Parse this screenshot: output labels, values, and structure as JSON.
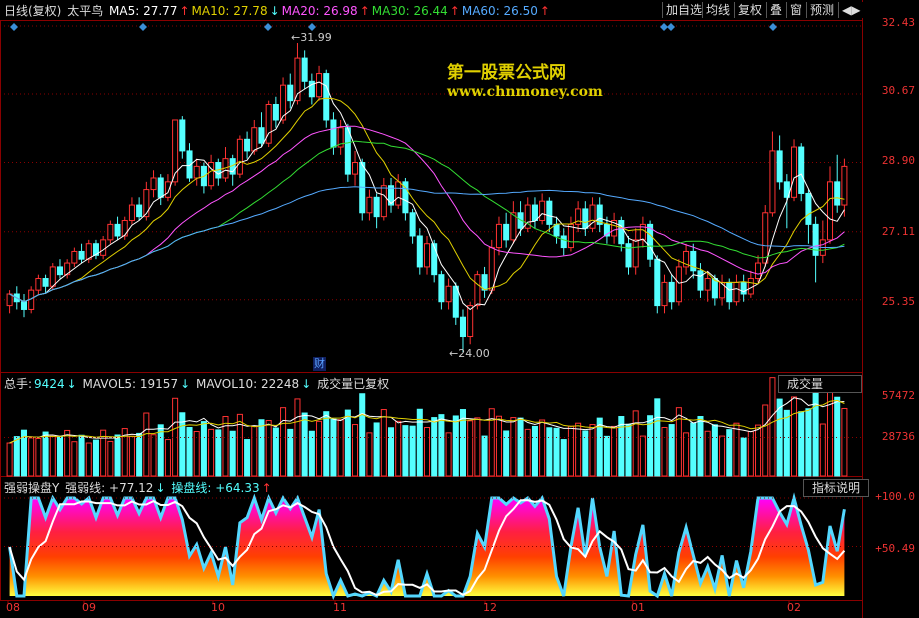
{
  "header": {
    "period": "日线(复权)",
    "symbol": "太平鸟",
    "ma": [
      {
        "label": "MA5: 27.77",
        "arrow": "↑",
        "color": "#ffffff"
      },
      {
        "label": "MA10: 27.78",
        "arrow": "↓",
        "color": "#e0d000"
      },
      {
        "label": "MA20: 26.98",
        "arrow": "↑",
        "color": "#ff55ff"
      },
      {
        "label": "MA30: 26.44",
        "arrow": "↑",
        "color": "#33dd33"
      },
      {
        "label": "MA60: 26.50",
        "arrow": "↑",
        "color": "#55aaff"
      }
    ]
  },
  "toolbar": {
    "add_watchlist": "加自选",
    "ma_line": "均线",
    "adjust": "复权",
    "overlay": "叠",
    "window": "窗",
    "predict": "预测",
    "nav": "◀▶"
  },
  "watermark": {
    "line1": "第一股票公式网",
    "line2": "www.chnmoney.com"
  },
  "price_axis": [
    "32.43",
    "30.67",
    "28.90",
    "27.11",
    "25.35"
  ],
  "annotations": {
    "high": "31.99",
    "low": "24.00",
    "finance_marker": "财"
  },
  "volume": {
    "title": "总手:",
    "value": "9424",
    "v_arrow": "↓",
    "mavol5": "MAVOL5: 19157",
    "m5_arrow": "↓",
    "mavol10": "MAVOL10: 22248",
    "m10_arrow": "↓",
    "note": "成交量已复权",
    "button": "成交量",
    "axis": [
      "57472",
      "28736"
    ]
  },
  "indicator": {
    "name": "强弱操盘Y",
    "line1": "强弱线: +77.12",
    "line1_arrow": "↓",
    "line2": "操盘线: +64.33",
    "line2_arrow": "↑",
    "button": "指标说明",
    "axis": [
      "+100.0",
      "+50.49"
    ]
  },
  "x_axis": [
    "08",
    "09",
    "10",
    "11",
    "12",
    "01",
    "02"
  ],
  "colors": {
    "up": "#ff3232",
    "down": "#54ffff",
    "bg": "#000000",
    "grid": "#8a0000"
  },
  "chart_data": {
    "type": "candlestick",
    "price": {
      "ylim": [
        24.0,
        32.43
      ],
      "candles": [
        [
          25.2,
          25.5,
          25.6,
          25.0
        ],
        [
          25.5,
          25.3,
          25.7,
          25.1
        ],
        [
          25.3,
          25.1,
          25.5,
          24.9
        ],
        [
          25.1,
          25.6,
          25.7,
          25.0
        ],
        [
          25.6,
          25.9,
          26.0,
          25.5
        ],
        [
          25.9,
          25.7,
          26.0,
          25.5
        ],
        [
          25.7,
          26.2,
          26.3,
          25.6
        ],
        [
          26.2,
          26.0,
          26.4,
          25.9
        ],
        [
          26.0,
          26.3,
          26.4,
          25.9
        ],
        [
          26.3,
          26.6,
          26.7,
          26.2
        ],
        [
          26.6,
          26.4,
          26.8,
          26.3
        ],
        [
          26.4,
          26.8,
          26.9,
          26.3
        ],
        [
          26.8,
          26.5,
          26.9,
          26.4
        ],
        [
          26.5,
          26.9,
          27.0,
          26.4
        ],
        [
          26.9,
          27.3,
          27.4,
          26.8
        ],
        [
          27.3,
          27.0,
          27.5,
          26.9
        ],
        [
          27.0,
          27.4,
          27.5,
          26.9
        ],
        [
          27.4,
          27.8,
          28.0,
          27.3
        ],
        [
          27.8,
          27.5,
          28.0,
          27.4
        ],
        [
          27.5,
          28.2,
          28.4,
          27.4
        ],
        [
          28.2,
          28.5,
          28.7,
          28.0
        ],
        [
          28.5,
          28.0,
          28.6,
          27.8
        ],
        [
          28.0,
          28.4,
          28.6,
          27.9
        ],
        [
          28.4,
          30.0,
          30.0,
          28.3
        ],
        [
          30.0,
          29.2,
          30.1,
          29.0
        ],
        [
          29.2,
          28.5,
          29.4,
          28.4
        ],
        [
          28.5,
          28.8,
          29.0,
          28.3
        ],
        [
          28.8,
          28.3,
          28.9,
          28.1
        ],
        [
          28.3,
          28.9,
          29.1,
          28.2
        ],
        [
          28.9,
          28.5,
          29.0,
          28.3
        ],
        [
          28.5,
          29.0,
          29.3,
          28.4
        ],
        [
          29.0,
          28.6,
          29.1,
          28.3
        ],
        [
          28.6,
          29.5,
          29.6,
          28.5
        ],
        [
          29.5,
          29.2,
          29.7,
          29.0
        ],
        [
          29.2,
          29.8,
          30.0,
          29.1
        ],
        [
          29.8,
          29.4,
          30.2,
          29.3
        ],
        [
          29.4,
          30.4,
          30.5,
          29.3
        ],
        [
          30.4,
          30.0,
          30.6,
          29.8
        ],
        [
          30.0,
          30.9,
          31.1,
          29.9
        ],
        [
          30.9,
          30.5,
          31.2,
          30.3
        ],
        [
          30.5,
          31.6,
          31.99,
          30.4
        ],
        [
          31.6,
          31.0,
          31.8,
          30.8
        ],
        [
          31.0,
          30.6,
          31.2,
          30.4
        ],
        [
          30.6,
          31.2,
          31.4,
          30.5
        ],
        [
          31.2,
          30.0,
          31.3,
          29.8
        ],
        [
          30.0,
          29.3,
          30.2,
          29.1
        ],
        [
          29.3,
          29.8,
          30.0,
          29.1
        ],
        [
          29.8,
          28.6,
          29.9,
          28.4
        ],
        [
          28.6,
          28.9,
          29.2,
          28.3
        ],
        [
          28.9,
          27.6,
          29.0,
          27.4
        ],
        [
          27.6,
          28.0,
          28.2,
          27.4
        ],
        [
          28.0,
          27.5,
          28.1,
          27.2
        ],
        [
          27.5,
          28.3,
          28.5,
          27.4
        ],
        [
          28.3,
          27.8,
          28.5,
          27.6
        ],
        [
          27.8,
          28.4,
          28.6,
          27.7
        ],
        [
          28.4,
          27.6,
          28.5,
          27.4
        ],
        [
          27.6,
          27.0,
          27.7,
          26.8
        ],
        [
          27.0,
          26.2,
          27.2,
          26.0
        ],
        [
          26.2,
          26.8,
          27.0,
          26.0
        ],
        [
          26.8,
          26.0,
          26.9,
          25.8
        ],
        [
          26.0,
          25.3,
          26.1,
          25.1
        ],
        [
          25.3,
          25.7,
          25.9,
          25.1
        ],
        [
          25.7,
          24.9,
          25.8,
          24.7
        ],
        [
          24.9,
          24.4,
          25.1,
          24.0
        ],
        [
          24.4,
          25.2,
          25.3,
          24.2
        ],
        [
          25.2,
          26.0,
          26.1,
          25.1
        ],
        [
          26.0,
          25.6,
          26.2,
          25.4
        ],
        [
          25.6,
          26.7,
          26.9,
          25.5
        ],
        [
          26.7,
          27.3,
          27.5,
          26.5
        ],
        [
          27.3,
          26.9,
          27.6,
          26.7
        ],
        [
          26.9,
          27.6,
          27.9,
          26.8
        ],
        [
          27.6,
          27.2,
          27.9,
          27.0
        ],
        [
          27.2,
          27.8,
          28.0,
          27.1
        ],
        [
          27.8,
          27.4,
          28.0,
          27.2
        ],
        [
          27.4,
          27.9,
          28.1,
          27.3
        ],
        [
          27.9,
          27.3,
          28.0,
          27.1
        ],
        [
          27.3,
          27.0,
          27.5,
          26.8
        ],
        [
          27.0,
          26.7,
          27.2,
          26.5
        ],
        [
          26.7,
          27.3,
          27.5,
          26.6
        ],
        [
          27.3,
          27.7,
          27.9,
          27.1
        ],
        [
          27.7,
          27.2,
          27.9,
          27.0
        ],
        [
          27.2,
          27.8,
          28.0,
          27.1
        ],
        [
          27.8,
          27.3,
          28.0,
          27.1
        ],
        [
          27.3,
          27.0,
          27.5,
          26.8
        ],
        [
          27.0,
          27.4,
          27.6,
          26.8
        ],
        [
          27.4,
          26.8,
          27.5,
          26.6
        ],
        [
          26.8,
          26.2,
          27.0,
          26.0
        ],
        [
          26.2,
          26.9,
          27.2,
          26.0
        ],
        [
          26.9,
          27.3,
          27.5,
          26.7
        ],
        [
          27.3,
          26.4,
          27.4,
          26.2
        ],
        [
          26.4,
          25.2,
          26.5,
          25.0
        ],
        [
          25.2,
          25.8,
          26.0,
          25.0
        ],
        [
          25.8,
          25.3,
          26.0,
          25.1
        ],
        [
          25.3,
          26.2,
          26.4,
          25.2
        ],
        [
          26.2,
          26.6,
          26.8,
          26.0
        ],
        [
          26.6,
          26.1,
          26.8,
          25.9
        ],
        [
          26.1,
          25.6,
          26.3,
          25.4
        ],
        [
          25.6,
          25.9,
          26.1,
          25.3
        ],
        [
          25.9,
          25.4,
          26.0,
          25.2
        ],
        [
          25.4,
          25.8,
          26.0,
          25.2
        ],
        [
          25.8,
          25.3,
          25.9,
          25.1
        ],
        [
          25.3,
          25.8,
          26.0,
          25.2
        ],
        [
          25.8,
          25.5,
          26.0,
          25.3
        ],
        [
          25.5,
          25.9,
          26.1,
          25.4
        ],
        [
          25.9,
          26.3,
          26.5,
          25.8
        ],
        [
          26.3,
          27.6,
          27.8,
          26.2
        ],
        [
          27.6,
          29.2,
          29.7,
          27.5
        ],
        [
          29.2,
          28.4,
          29.6,
          28.2
        ],
        [
          28.4,
          28.0,
          28.6,
          27.2
        ],
        [
          28.0,
          29.3,
          29.5,
          27.9
        ],
        [
          29.3,
          28.1,
          29.4,
          27.9
        ],
        [
          28.1,
          27.3,
          28.2,
          26.8
        ],
        [
          27.3,
          26.5,
          27.5,
          25.8
        ],
        [
          26.5,
          26.9,
          27.4,
          26.3
        ],
        [
          26.9,
          28.4,
          28.8,
          26.8
        ],
        [
          28.4,
          27.8,
          29.1,
          27.6
        ],
        [
          27.8,
          28.8,
          29.0,
          27.5
        ]
      ],
      "ma_series_names": [
        "MA5",
        "MA10",
        "MA20",
        "MA30",
        "MA60"
      ]
    },
    "volume_ylim": [
      0,
      57472
    ]
  }
}
